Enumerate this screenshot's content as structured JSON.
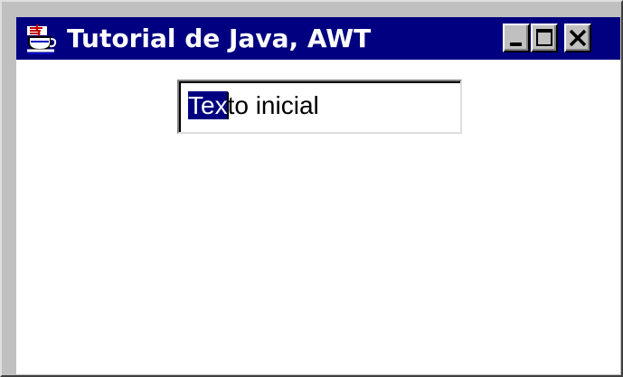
{
  "window": {
    "title": "Tutorial de Java, AWT",
    "icon": "java-coffee-cup-icon",
    "controls": {
      "minimize": "minimize-icon",
      "maximize": "maximize-icon",
      "close": "close-icon"
    },
    "colors": {
      "titlebar": "#000080",
      "frame": "#c0c0c0",
      "client": "#ffffff",
      "selection": "#000080"
    }
  },
  "textfield": {
    "selected_text": "Tex",
    "rest_text": "to inicial"
  }
}
